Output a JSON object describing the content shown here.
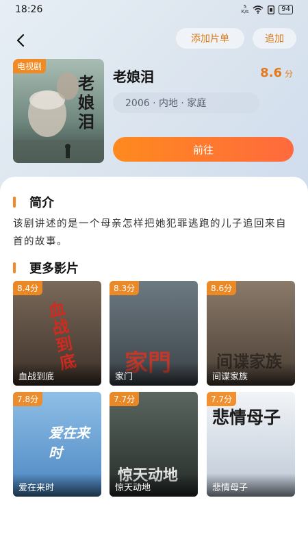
{
  "status": {
    "time": "18:26",
    "net_value": "5",
    "net_unit": "K/s",
    "battery": "94"
  },
  "header": {
    "add_list_label": "添加片单",
    "follow_label": "追加"
  },
  "detail": {
    "tag": "电视剧",
    "title": "老娘泪",
    "score": "8.6",
    "score_unit": "分",
    "meta": "2006 · 内地 · 家庭",
    "go_label": "前往",
    "poster_text": "老娘泪"
  },
  "intro": {
    "heading": "简介",
    "text": "该剧讲述的是一个母亲怎样把她犯罪逃跑的儿子追回来自首的故事。"
  },
  "more": {
    "heading": "更多影片",
    "items": [
      {
        "score": "8.4分",
        "title": "血战到底",
        "art": "血战到底",
        "color": "#5a4a3a"
      },
      {
        "score": "8.3分",
        "title": "家门",
        "art": "家門",
        "color": "#4a5560"
      },
      {
        "score": "8.6分",
        "title": "间谍家族",
        "art": "间谍家族",
        "color": "#6a5a4a"
      },
      {
        "score": "7.8分",
        "title": "爱在来时",
        "art": "爱在来时",
        "color": "#5a8fc8"
      },
      {
        "score": "7.7分",
        "title": "惊天动地",
        "art": "惊天动地",
        "color": "#3e4540"
      },
      {
        "score": "7.7分",
        "title": "悲情母子",
        "art": "悲情母子",
        "color": "#dfe6ee"
      }
    ]
  }
}
